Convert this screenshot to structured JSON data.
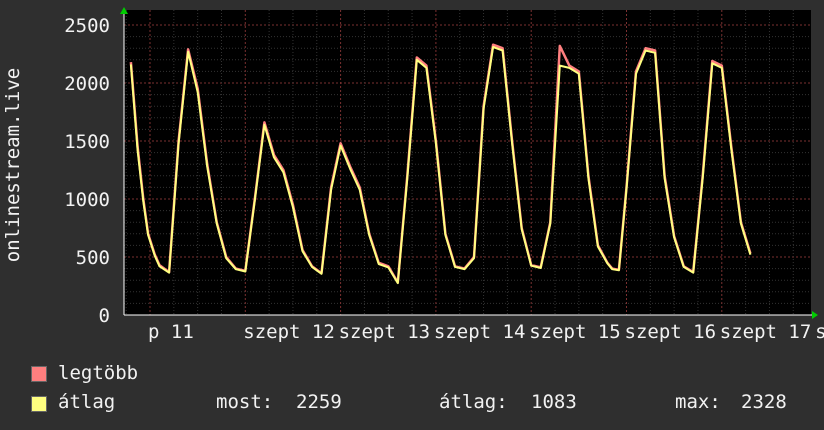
{
  "chart_data": {
    "type": "line",
    "ylabel": "onlinestream.live",
    "ylim": [
      0,
      2500
    ],
    "yticks": [
      "0",
      "500",
      "1000",
      "1500",
      "2000",
      "2500"
    ],
    "grid": true,
    "x_tick_labels": [
      "p 11",
      "szept 12",
      "szept 13",
      "szept 14",
      "szept 15",
      "szept 16",
      "szept 17",
      "sz"
    ],
    "x_tick_day_index": [
      0,
      1,
      2,
      3,
      4,
      5,
      6,
      7
    ],
    "series": [
      {
        "name": "legtöbb",
        "color": "#ff7f7f",
        "x": [
          -0.2,
          -0.13,
          -0.07,
          -0.02,
          0.05,
          0.1,
          0.2,
          0.3,
          0.4,
          0.5,
          0.6,
          0.7,
          0.8,
          0.9,
          1.0,
          1.1,
          1.2,
          1.3,
          1.4,
          1.5,
          1.6,
          1.7,
          1.8,
          1.9,
          2.0,
          2.1,
          2.2,
          2.3,
          2.4,
          2.5,
          2.6,
          2.7,
          2.8,
          2.9,
          3.0,
          3.1,
          3.2,
          3.3,
          3.4,
          3.5,
          3.6,
          3.7,
          3.8,
          3.9,
          4.0,
          4.1,
          4.2,
          4.3,
          4.4,
          4.5,
          4.6,
          4.7,
          4.8,
          4.85,
          4.92,
          5.0,
          5.1,
          5.2,
          5.3,
          5.4,
          5.5,
          5.6,
          5.7,
          5.8,
          5.9,
          6.0,
          6.1,
          6.2,
          6.3
        ],
        "values": [
          2180,
          1450,
          1000,
          700,
          520,
          430,
          370,
          1500,
          2290,
          1950,
          1300,
          800,
          500,
          400,
          380,
          1000,
          1660,
          1380,
          1250,
          950,
          560,
          420,
          360,
          1100,
          1480,
          1280,
          1100,
          700,
          450,
          420,
          280,
          1200,
          2220,
          2150,
          1500,
          700,
          420,
          400,
          500,
          1800,
          2330,
          2300,
          1500,
          750,
          430,
          410,
          800,
          2320,
          2150,
          2100,
          1200,
          600,
          450,
          400,
          390,
          1100,
          2100,
          2300,
          2280,
          1200,
          680,
          420,
          370,
          1200,
          2190,
          2150,
          1450,
          800,
          530
        ],
        "mix": 0
      },
      {
        "name": "átlag",
        "color": "#ffff80",
        "x": [
          -0.2,
          -0.13,
          -0.07,
          -0.02,
          0.05,
          0.1,
          0.2,
          0.3,
          0.4,
          0.5,
          0.6,
          0.7,
          0.8,
          0.9,
          1.0,
          1.1,
          1.2,
          1.3,
          1.4,
          1.5,
          1.6,
          1.7,
          1.8,
          1.9,
          2.0,
          2.1,
          2.2,
          2.3,
          2.4,
          2.5,
          2.6,
          2.7,
          2.8,
          2.9,
          3.0,
          3.1,
          3.2,
          3.3,
          3.4,
          3.5,
          3.6,
          3.7,
          3.8,
          3.9,
          4.0,
          4.1,
          4.2,
          4.3,
          4.4,
          4.5,
          4.6,
          4.7,
          4.8,
          4.85,
          4.92,
          5.0,
          5.1,
          5.2,
          5.3,
          5.4,
          5.5,
          5.6,
          5.7,
          5.8,
          5.9,
          6.0,
          6.1,
          6.2,
          6.3
        ],
        "values": [
          2160,
          1420,
          980,
          690,
          510,
          420,
          365,
          1480,
          2270,
          1920,
          1280,
          790,
          490,
          395,
          375,
          990,
          1640,
          1360,
          1230,
          930,
          550,
          415,
          355,
          1080,
          1460,
          1260,
          1080,
          690,
          440,
          410,
          275,
          1180,
          2200,
          2130,
          1480,
          690,
          415,
          395,
          490,
          1780,
          2310,
          2280,
          1480,
          740,
          425,
          405,
          790,
          2150,
          2130,
          2080,
          1180,
          590,
          445,
          395,
          385,
          1090,
          2080,
          2280,
          2260,
          1180,
          670,
          415,
          365,
          1180,
          2170,
          2130,
          1430,
          790,
          520
        ],
        "mix": 0
      }
    ],
    "stats": {
      "now_label": "most:",
      "now": "2259",
      "avg_label": "átlag:",
      "avg": "1083",
      "max_label": "max:",
      "max": "2328"
    }
  }
}
